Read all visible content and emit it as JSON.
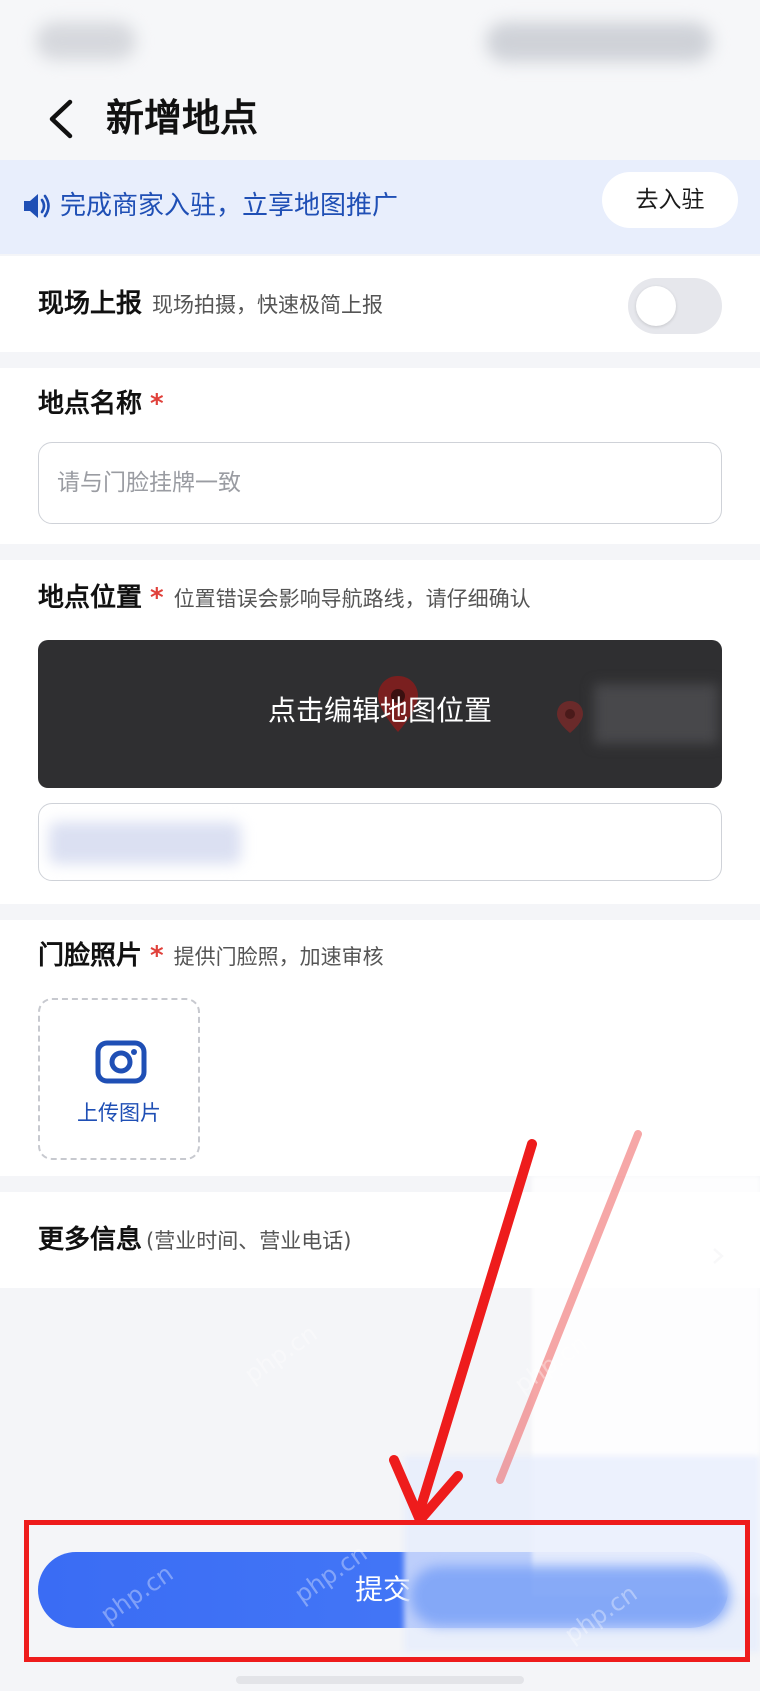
{
  "header": {
    "title": "新增地点"
  },
  "promo": {
    "text": "完成商家入驻，立享地图推广",
    "join_label": "去入驻"
  },
  "onsite_report": {
    "title": "现场上报",
    "hint": "现场拍摄，快速极简上报",
    "enabled": false
  },
  "place_name": {
    "title": "地点名称",
    "required_mark": "*",
    "placeholder": "请与门脸挂牌一致"
  },
  "place_location": {
    "title": "地点位置",
    "required_mark": "*",
    "hint": "位置错误会影响导航路线，请仔细确认",
    "map_label": "点击编辑地图位置"
  },
  "storefront_photo": {
    "title": "门脸照片",
    "required_mark": "*",
    "hint": "提供门脸照，加速审核",
    "upload_label": "上传图片"
  },
  "more_info": {
    "title": "更多信息",
    "hint": "(营业时间、营业电话)"
  },
  "submit": {
    "label": "提交"
  },
  "watermark": "php.cn",
  "colors": {
    "accent": "#3a6cf4",
    "link": "#1f4fb5",
    "required": "#e0413b",
    "annotation_red": "#ee1c1c"
  }
}
